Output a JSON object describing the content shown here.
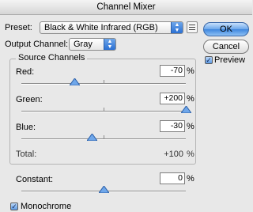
{
  "window": {
    "title": "Channel Mixer"
  },
  "preset": {
    "label": "Preset:",
    "value": "Black & White Infrared (RGB)",
    "menu_icon": "list-menu-icon"
  },
  "output_channel": {
    "label": "Output Channel:",
    "value": "Gray"
  },
  "buttons": {
    "ok": "OK",
    "cancel": "Cancel"
  },
  "preview": {
    "label": "Preview",
    "checked": true
  },
  "source_channels": {
    "title": "Source Channels",
    "red": {
      "label": "Red:",
      "value": "-70",
      "unit": "%",
      "percent": -70
    },
    "green": {
      "label": "Green:",
      "value": "+200",
      "unit": "%",
      "percent": 200
    },
    "blue": {
      "label": "Blue:",
      "value": "-30",
      "unit": "%",
      "percent": -30
    },
    "total": {
      "label": "Total:",
      "value": "+100",
      "unit": "%"
    }
  },
  "constant": {
    "label": "Constant:",
    "value": "0",
    "unit": "%",
    "percent": 0
  },
  "monochrome": {
    "label": "Monochrome",
    "checked": true
  },
  "colors": {
    "accent": "#3d86de",
    "thumb": "#6fa7ea"
  }
}
